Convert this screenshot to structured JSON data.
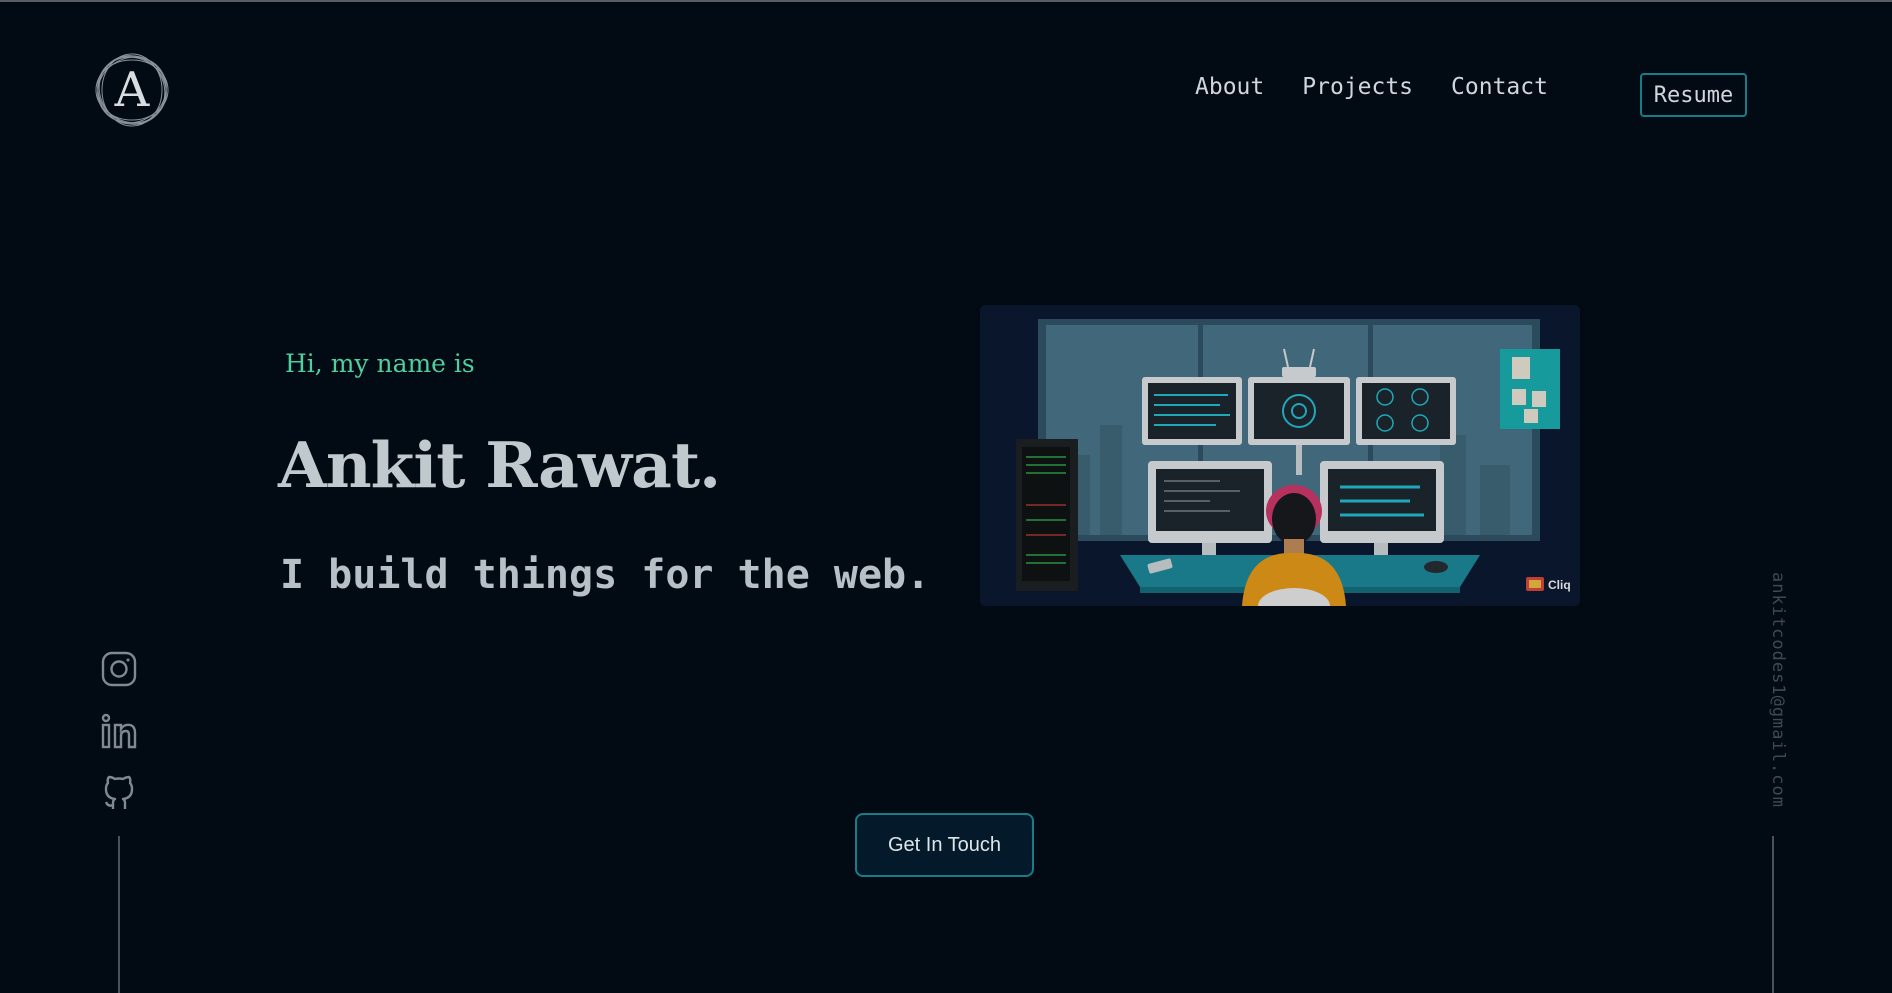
{
  "logo": {
    "letter": "A"
  },
  "nav": {
    "links": [
      {
        "label": "About"
      },
      {
        "label": "Projects"
      },
      {
        "label": "Contact"
      }
    ],
    "resume_label": "Resume"
  },
  "hero": {
    "greeting": "Hi, my name is",
    "name": "Ankit Rawat.",
    "tagline": "I build things for the web.",
    "illustration_badge": "Cliq",
    "cta_label": "Get In Touch"
  },
  "socials": [
    {
      "icon": "instagram-icon"
    },
    {
      "icon": "linkedin-icon"
    },
    {
      "icon": "github-icon"
    }
  ],
  "email": "ankitcodes1@gmail.com",
  "colors": {
    "background": "#020a14",
    "accent_green": "#4fcf9e",
    "accent_teal": "#177e89",
    "text_light": "#cfd6dc"
  }
}
